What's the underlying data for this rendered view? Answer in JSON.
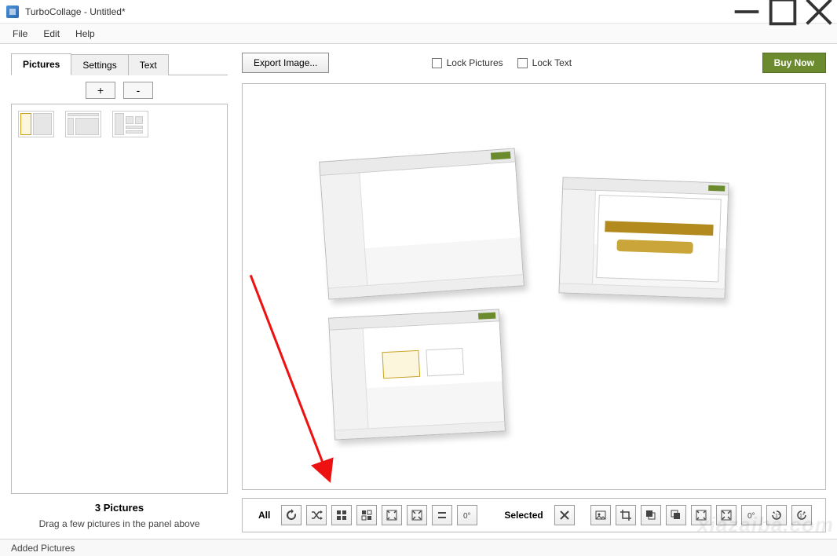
{
  "window": {
    "title": "TurboCollage - Untitled*"
  },
  "menu": {
    "items": [
      "File",
      "Edit",
      "Help"
    ]
  },
  "left": {
    "tabs": [
      "Pictures",
      "Settings",
      "Text"
    ],
    "active_tab": 0,
    "plus_label": "+",
    "minus_label": "-",
    "picture_count_label": "3 Pictures",
    "hint": "Drag a few pictures in the panel above"
  },
  "top_toolbar": {
    "export_label": "Export Image...",
    "lock_pictures_label": "Lock Pictures",
    "lock_text_label": "Lock Text",
    "buy_now_label": "Buy Now"
  },
  "bottom_toolbar": {
    "all_label": "All",
    "selected_label": "Selected",
    "all_buttons": [
      "refresh",
      "shuffle",
      "grid",
      "grid-alt",
      "fit",
      "fill",
      "equalize",
      "rotate-zero"
    ],
    "selected_buttons": [
      "delete",
      "picture",
      "crop",
      "send-back",
      "bring-front",
      "fit-selected",
      "fill-selected",
      "rotate-zero-selected",
      "rotate-ccw",
      "rotate-cw"
    ]
  },
  "status": {
    "text": "Added Pictures"
  },
  "watermark": "xiazaiba.com"
}
